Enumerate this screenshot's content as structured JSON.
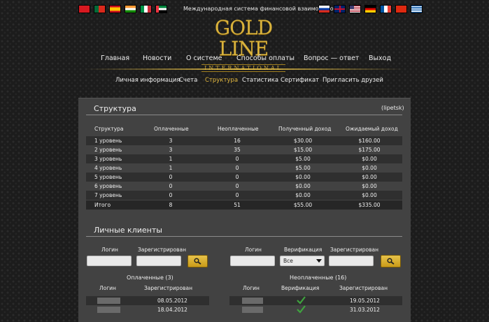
{
  "header": {
    "tagline": "Международная система финансовой взаимопомощи",
    "logo_main": "GOLD LINE",
    "logo_sub": "INTERNATIONAL",
    "flags_left": [
      "turkey-flag",
      "portugal-flag",
      "spain-flag",
      "india-flag",
      "italy-flag",
      "uae-flag"
    ],
    "flags_right": [
      "russia-flag",
      "uk-flag",
      "usa-flag",
      "germany-flag",
      "france-flag",
      "china-flag",
      "greece-flag"
    ]
  },
  "nav": {
    "items": [
      "Главная",
      "Новости",
      "О системе",
      "Способы оплаты",
      "Вопрос — ответ",
      "Выход"
    ]
  },
  "subnav": {
    "items": [
      "Личная информация",
      "Счета",
      "Структура",
      "Статистика",
      "Сертификат",
      "Пригласить друзей"
    ],
    "active": "Структура"
  },
  "structure": {
    "title": "Структура",
    "user": "(lipetsk)",
    "headers": [
      "Структура",
      "Оплаченные",
      "Неоплаченные",
      "Полученный доход",
      "Ожидаемый доход"
    ],
    "rows": [
      [
        "1 уровень",
        "3",
        "16",
        "$30.00",
        "$160.00"
      ],
      [
        "2 уровень",
        "3",
        "35",
        "$15.00",
        "$175.00"
      ],
      [
        "3 уровень",
        "1",
        "0",
        "$5.00",
        "$0.00"
      ],
      [
        "4 уровень",
        "1",
        "0",
        "$5.00",
        "$0.00"
      ],
      [
        "5 уровень",
        "0",
        "0",
        "$0.00",
        "$0.00"
      ],
      [
        "6 уровень",
        "0",
        "0",
        "$0.00",
        "$0.00"
      ],
      [
        "7 уровень",
        "0",
        "0",
        "$0.00",
        "$0.00"
      ]
    ],
    "total": [
      "Итого",
      "8",
      "51",
      "$55.00",
      "$335.00"
    ]
  },
  "clients": {
    "title": "Личные клиенты",
    "left_filter": {
      "login_label": "Логин",
      "registered_label": "Зарегистрирован"
    },
    "right_filter": {
      "login_label": "Логин",
      "verification_label": "Верификация",
      "registered_label": "Зарегистрирован",
      "verification_value": "Все"
    },
    "paid": {
      "title": "Оплаченные (3)",
      "headers": [
        "Логин",
        "Зарегистрирован"
      ],
      "rows": [
        "08.05.2012",
        "18.04.2012"
      ]
    },
    "unpaid": {
      "title": "Неоплаченные (16)",
      "headers": [
        "Логин",
        "Верификация",
        "Зарегистрирован"
      ],
      "rows": [
        "19.05.2012",
        "31.03.2012"
      ]
    }
  },
  "colors": {
    "gold": "#e0b63e",
    "panel": "#424242",
    "row_dark": "#2f2f2f",
    "check": "#3fa33f"
  }
}
